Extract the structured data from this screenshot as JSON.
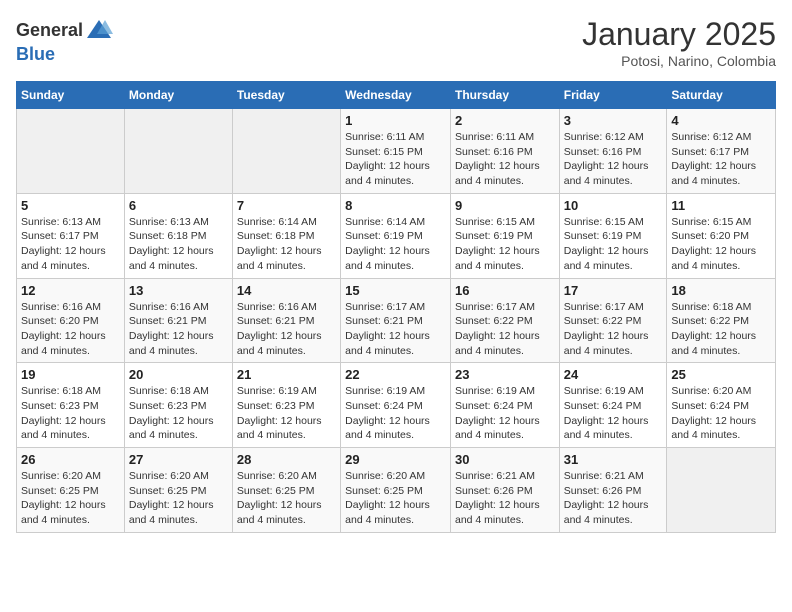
{
  "header": {
    "logo_general": "General",
    "logo_blue": "Blue",
    "month_title": "January 2025",
    "location": "Potosi, Narino, Colombia"
  },
  "weekdays": [
    "Sunday",
    "Monday",
    "Tuesday",
    "Wednesday",
    "Thursday",
    "Friday",
    "Saturday"
  ],
  "weeks": [
    [
      {
        "day": "",
        "info": ""
      },
      {
        "day": "",
        "info": ""
      },
      {
        "day": "",
        "info": ""
      },
      {
        "day": "1",
        "info": "Sunrise: 6:11 AM\nSunset: 6:15 PM\nDaylight: 12 hours and 4 minutes."
      },
      {
        "day": "2",
        "info": "Sunrise: 6:11 AM\nSunset: 6:16 PM\nDaylight: 12 hours and 4 minutes."
      },
      {
        "day": "3",
        "info": "Sunrise: 6:12 AM\nSunset: 6:16 PM\nDaylight: 12 hours and 4 minutes."
      },
      {
        "day": "4",
        "info": "Sunrise: 6:12 AM\nSunset: 6:17 PM\nDaylight: 12 hours and 4 minutes."
      }
    ],
    [
      {
        "day": "5",
        "info": "Sunrise: 6:13 AM\nSunset: 6:17 PM\nDaylight: 12 hours and 4 minutes."
      },
      {
        "day": "6",
        "info": "Sunrise: 6:13 AM\nSunset: 6:18 PM\nDaylight: 12 hours and 4 minutes."
      },
      {
        "day": "7",
        "info": "Sunrise: 6:14 AM\nSunset: 6:18 PM\nDaylight: 12 hours and 4 minutes."
      },
      {
        "day": "8",
        "info": "Sunrise: 6:14 AM\nSunset: 6:19 PM\nDaylight: 12 hours and 4 minutes."
      },
      {
        "day": "9",
        "info": "Sunrise: 6:15 AM\nSunset: 6:19 PM\nDaylight: 12 hours and 4 minutes."
      },
      {
        "day": "10",
        "info": "Sunrise: 6:15 AM\nSunset: 6:19 PM\nDaylight: 12 hours and 4 minutes."
      },
      {
        "day": "11",
        "info": "Sunrise: 6:15 AM\nSunset: 6:20 PM\nDaylight: 12 hours and 4 minutes."
      }
    ],
    [
      {
        "day": "12",
        "info": "Sunrise: 6:16 AM\nSunset: 6:20 PM\nDaylight: 12 hours and 4 minutes."
      },
      {
        "day": "13",
        "info": "Sunrise: 6:16 AM\nSunset: 6:21 PM\nDaylight: 12 hours and 4 minutes."
      },
      {
        "day": "14",
        "info": "Sunrise: 6:16 AM\nSunset: 6:21 PM\nDaylight: 12 hours and 4 minutes."
      },
      {
        "day": "15",
        "info": "Sunrise: 6:17 AM\nSunset: 6:21 PM\nDaylight: 12 hours and 4 minutes."
      },
      {
        "day": "16",
        "info": "Sunrise: 6:17 AM\nSunset: 6:22 PM\nDaylight: 12 hours and 4 minutes."
      },
      {
        "day": "17",
        "info": "Sunrise: 6:17 AM\nSunset: 6:22 PM\nDaylight: 12 hours and 4 minutes."
      },
      {
        "day": "18",
        "info": "Sunrise: 6:18 AM\nSunset: 6:22 PM\nDaylight: 12 hours and 4 minutes."
      }
    ],
    [
      {
        "day": "19",
        "info": "Sunrise: 6:18 AM\nSunset: 6:23 PM\nDaylight: 12 hours and 4 minutes."
      },
      {
        "day": "20",
        "info": "Sunrise: 6:18 AM\nSunset: 6:23 PM\nDaylight: 12 hours and 4 minutes."
      },
      {
        "day": "21",
        "info": "Sunrise: 6:19 AM\nSunset: 6:23 PM\nDaylight: 12 hours and 4 minutes."
      },
      {
        "day": "22",
        "info": "Sunrise: 6:19 AM\nSunset: 6:24 PM\nDaylight: 12 hours and 4 minutes."
      },
      {
        "day": "23",
        "info": "Sunrise: 6:19 AM\nSunset: 6:24 PM\nDaylight: 12 hours and 4 minutes."
      },
      {
        "day": "24",
        "info": "Sunrise: 6:19 AM\nSunset: 6:24 PM\nDaylight: 12 hours and 4 minutes."
      },
      {
        "day": "25",
        "info": "Sunrise: 6:20 AM\nSunset: 6:24 PM\nDaylight: 12 hours and 4 minutes."
      }
    ],
    [
      {
        "day": "26",
        "info": "Sunrise: 6:20 AM\nSunset: 6:25 PM\nDaylight: 12 hours and 4 minutes."
      },
      {
        "day": "27",
        "info": "Sunrise: 6:20 AM\nSunset: 6:25 PM\nDaylight: 12 hours and 4 minutes."
      },
      {
        "day": "28",
        "info": "Sunrise: 6:20 AM\nSunset: 6:25 PM\nDaylight: 12 hours and 4 minutes."
      },
      {
        "day": "29",
        "info": "Sunrise: 6:20 AM\nSunset: 6:25 PM\nDaylight: 12 hours and 4 minutes."
      },
      {
        "day": "30",
        "info": "Sunrise: 6:21 AM\nSunset: 6:26 PM\nDaylight: 12 hours and 4 minutes."
      },
      {
        "day": "31",
        "info": "Sunrise: 6:21 AM\nSunset: 6:26 PM\nDaylight: 12 hours and 4 minutes."
      },
      {
        "day": "",
        "info": ""
      }
    ]
  ]
}
